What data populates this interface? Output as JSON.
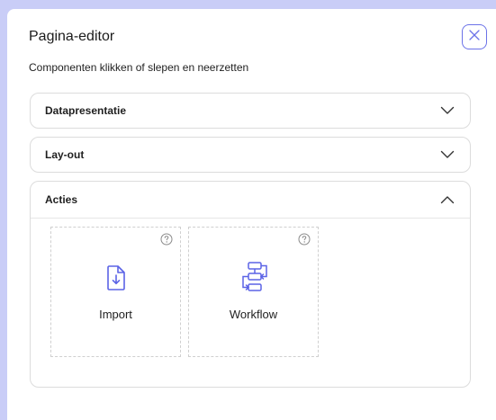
{
  "dialog": {
    "title": "Pagina-editor",
    "subtitle": "Componenten klikken of slepen en neerzetten"
  },
  "sections": [
    {
      "label": "Datapresentatie",
      "expanded": false
    },
    {
      "label": "Lay-out",
      "expanded": false
    },
    {
      "label": "Acties",
      "expanded": true
    }
  ],
  "components": [
    {
      "label": "Import",
      "icon": "import-file-icon"
    },
    {
      "label": "Workflow",
      "icon": "workflow-icon"
    }
  ],
  "colors": {
    "accent": "#5b63e6",
    "backdrop": "#c9cdf7",
    "border": "#dcdcdc"
  }
}
